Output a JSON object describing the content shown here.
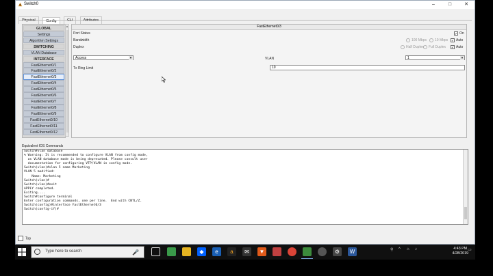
{
  "window": {
    "title": "Switch0",
    "controls": [
      "–",
      "□",
      "✕"
    ]
  },
  "tabs": [
    {
      "label": "Physical"
    },
    {
      "label": "Config"
    },
    {
      "label": "CLI"
    },
    {
      "label": "Attributes"
    }
  ],
  "sidebar": {
    "items": [
      {
        "label": "GLOBAL"
      },
      {
        "label": "Settings"
      },
      {
        "label": "Algorithm Settings"
      },
      {
        "label": "SWITCHING"
      },
      {
        "label": "VLAN Database"
      },
      {
        "label": "INTERFACE"
      },
      {
        "label": "FastEthernet0/1"
      },
      {
        "label": "FastEthernet0/2"
      },
      {
        "label": "FastEthernet0/3"
      },
      {
        "label": "FastEthernet0/4"
      },
      {
        "label": "FastEthernet0/5"
      },
      {
        "label": "FastEthernet0/6"
      },
      {
        "label": "FastEthernet0/7"
      },
      {
        "label": "FastEthernet0/8"
      },
      {
        "label": "FastEthernet0/9"
      },
      {
        "label": "FastEthernet0/10"
      },
      {
        "label": "FastEthernet0/11"
      },
      {
        "label": "FastEthernet0/12"
      }
    ]
  },
  "panel": {
    "title": "FastEthernet0/3",
    "port_status": {
      "label": "Port Status",
      "on_label": "On"
    },
    "bandwidth": {
      "label": "Bandwidth",
      "opt1": "100 Mbps",
      "opt2": "10 Mbps",
      "auto_label": "Auto"
    },
    "duplex": {
      "label": "Duplex",
      "opt1": "Half Duplex",
      "opt2": "Full Duplex",
      "auto_label": "Auto"
    },
    "mode_select": "Access",
    "vlan": {
      "label": "VLAN",
      "value": "1"
    },
    "tx_ring": {
      "label": "Tx Ring Limit",
      "value": "10"
    }
  },
  "console": {
    "label": "Equivalent IOS Commands",
    "lines": [
      "Switch#vlan database",
      "% Warning: It is recommended to configure VLAN from config mode,",
      "  as VLAN database mode is being deprecated. Please consult user",
      "  documentation for configuring VTP/VLAN in config mode.",
      "",
      "Switch(vlan)#vlan 5 name Marketing",
      "VLAN 5 modified:",
      "    Name: Marketing",
      "Switch(vlan)#",
      "Switch(vlan)#exit",
      "APPLY completed.",
      "Exiting....",
      "Switch#configure terminal",
      "Enter configuration commands, one per line.  End with CNTL/Z.",
      "Switch(config)#interface FastEthernet0/3",
      "Switch(config-if)#"
    ]
  },
  "top_checkbox": {
    "label": "Top"
  },
  "taskbar": {
    "search_placeholder": "Type here to search",
    "time": "4:43 PM",
    "date": "4/28/2019"
  }
}
